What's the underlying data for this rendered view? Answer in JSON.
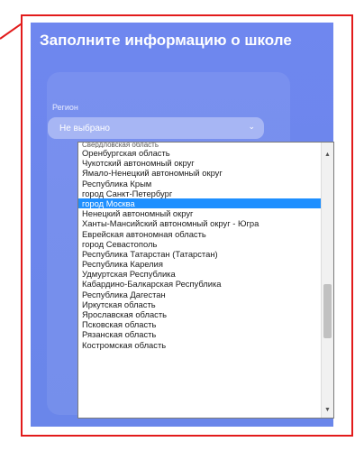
{
  "form": {
    "title": "Заполните информацию о школе",
    "region_label": "Регион",
    "region_value": "Не выбрано"
  },
  "dropdown": {
    "partial_top": "Свердловская область",
    "options": [
      "Оренбургская область",
      "Чукотский автономный округ",
      "Ямало-Ненецкий автономный округ",
      "Республика Крым",
      "город Санкт-Петербург",
      "город Москва",
      "Ненецкий автономный округ",
      "Ханты-Мансийский автономный округ - Югра",
      "Еврейская автономная область",
      "город Севастополь",
      "Республика Татарстан (Татарстан)",
      "Республика Карелия",
      "Удмуртская Республика",
      "Кабардино-Балкарская Республика",
      "Республика Дагестан",
      "Иркутская область",
      "Ярославская область",
      "Псковская область",
      "Рязанская область",
      "Костромская область"
    ],
    "selected_index": 5
  },
  "colors": {
    "annotation": "#e21b1b",
    "panel": "#6c86ec",
    "selected": "#1e8fff"
  },
  "icons": {
    "select_chevron": "chevron-down-icon",
    "scroll_up": "triangle-up-icon",
    "scroll_down": "triangle-down-icon"
  }
}
